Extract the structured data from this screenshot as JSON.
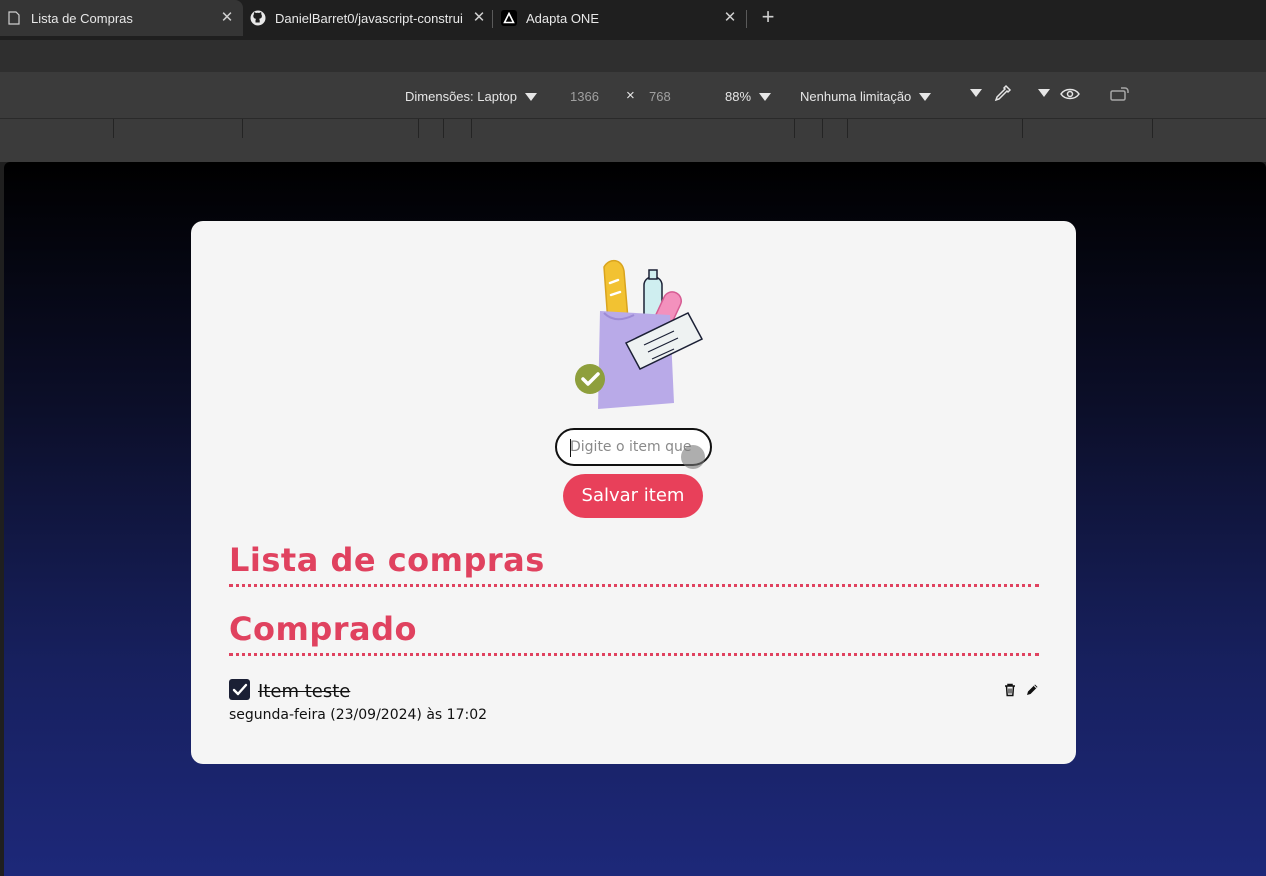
{
  "browser": {
    "tabs": [
      {
        "title": "Lista de Compras",
        "active": true,
        "icon": "document-icon"
      },
      {
        "title": "DanielBarret0/javascript-construi",
        "active": false,
        "icon": "github-icon"
      },
      {
        "title": "Adapta ONE",
        "active": false,
        "icon": "adapta-logo-icon"
      }
    ],
    "new_tab_icon": "plus-icon"
  },
  "devtools": {
    "dimensions_label": "Dimensões: Laptop",
    "width": "1366",
    "times": "×",
    "height": "768",
    "zoom": "88%",
    "throttling": "Nenhuma limitação"
  },
  "app": {
    "input": {
      "placeholder": "Digite o item que"
    },
    "save_label": "Salvar item",
    "list_title": "Lista de compras",
    "bought_title": "Comprado",
    "items": [
      {
        "name": "Item teste",
        "date": "segunda-feira (23/09/2024) às 17:02",
        "checked": true
      }
    ]
  },
  "colors": {
    "accent": "#e8405a",
    "checkbox": "#1b2035",
    "card": "#f5f5f5"
  }
}
